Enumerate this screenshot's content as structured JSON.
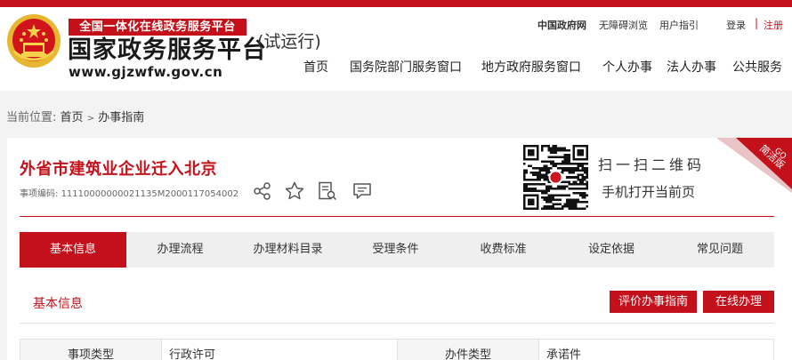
{
  "header": {
    "logo_tag": "全国一体化在线政务服务平台",
    "logo_title": "国家政务服务平台",
    "logo_url": "www.gjzwfw.gov.cn",
    "trial": "(试运行)",
    "util_links": [
      "中国政府网",
      "无障碍浏览",
      "用户指引"
    ],
    "login": "登录",
    "separator": "|",
    "register": "注册",
    "nav": [
      "首页",
      "国务院部门服务窗口",
      "地方政府服务窗口",
      "个人办事",
      "法人办事",
      "公共服务"
    ]
  },
  "breadcrumb": {
    "prefix": "当前位置:",
    "home": "首页",
    "arrow": ">",
    "current": "办事指南"
  },
  "item": {
    "title": "外省市建筑业企业迁入北京",
    "code_label": "事项编码:",
    "code": "11110000000021135M2000117054002"
  },
  "qr": {
    "line1": "扫一扫二维码",
    "line2": "手机打开当前页"
  },
  "corner_badge": {
    "go": "GO",
    "text": "简洁版"
  },
  "tabs": [
    "基本信息",
    "办理流程",
    "办理材料目录",
    "受理条件",
    "收费标准",
    "设定依据",
    "常见问题"
  ],
  "section": {
    "title": "基本信息",
    "buttons": [
      "评价办事指南",
      "在线办理"
    ]
  },
  "info_row": {
    "label1": "事项类型",
    "value1": "行政许可",
    "label2": "办件类型",
    "value2": "承诺件"
  },
  "colors": {
    "brand_red": "#c3101a",
    "tab_bg": "#efefef",
    "page_bg": "#f3f3f3"
  },
  "icons": [
    "national-emblem-icon",
    "share-icon",
    "star-icon",
    "form-search-icon",
    "comment-icon",
    "qr-code-icon"
  ]
}
